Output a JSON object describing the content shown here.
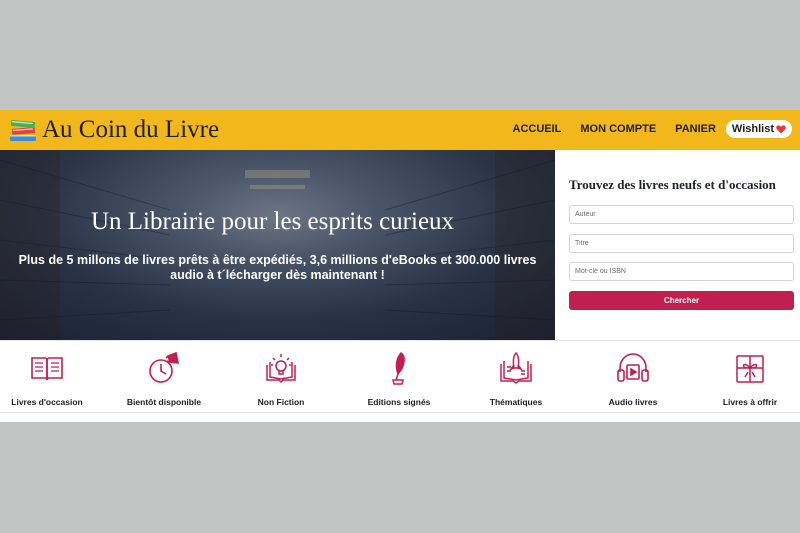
{
  "header": {
    "logo_text": "Au Coin du Livre",
    "nav": [
      {
        "label": "ACCUEIL"
      },
      {
        "label": "MON COMPTE"
      },
      {
        "label": "PANIER"
      }
    ],
    "wishlist_label": "Wishlist"
  },
  "hero": {
    "title": "Un Librairie pour les esprits curieux",
    "subtitle": "Plus de 5 millons de livres prêts à être expédiés, 3,6 millions d'eBooks et 300.000 livres audio à t´lécharger dès maintenant !"
  },
  "search": {
    "title": "Trouvez des livres neufs et d'occasion",
    "author_placeholder": "Auteur",
    "title_placeholder": "Titre",
    "keyword_placeholder": "Mot-clé ou ISBN",
    "button_label": "Chercher"
  },
  "categories": [
    {
      "label": "Livres d'occasion",
      "icon": "open-book-icon"
    },
    {
      "label": "Bientôt disponible",
      "icon": "clock-megaphone-icon"
    },
    {
      "label": "Non Fiction",
      "icon": "lightbulb-book-icon"
    },
    {
      "label": "Editions signés",
      "icon": "quill-ink-icon"
    },
    {
      "label": "Thématiques",
      "icon": "rocket-book-icon"
    },
    {
      "label": "Audio livres",
      "icon": "headphones-icon"
    },
    {
      "label": "Livres à offrir",
      "icon": "gift-book-icon"
    }
  ],
  "colors": {
    "header_bg": "#f2b81b",
    "accent": "#c01f50",
    "page_bg": "#c1c6c5"
  }
}
